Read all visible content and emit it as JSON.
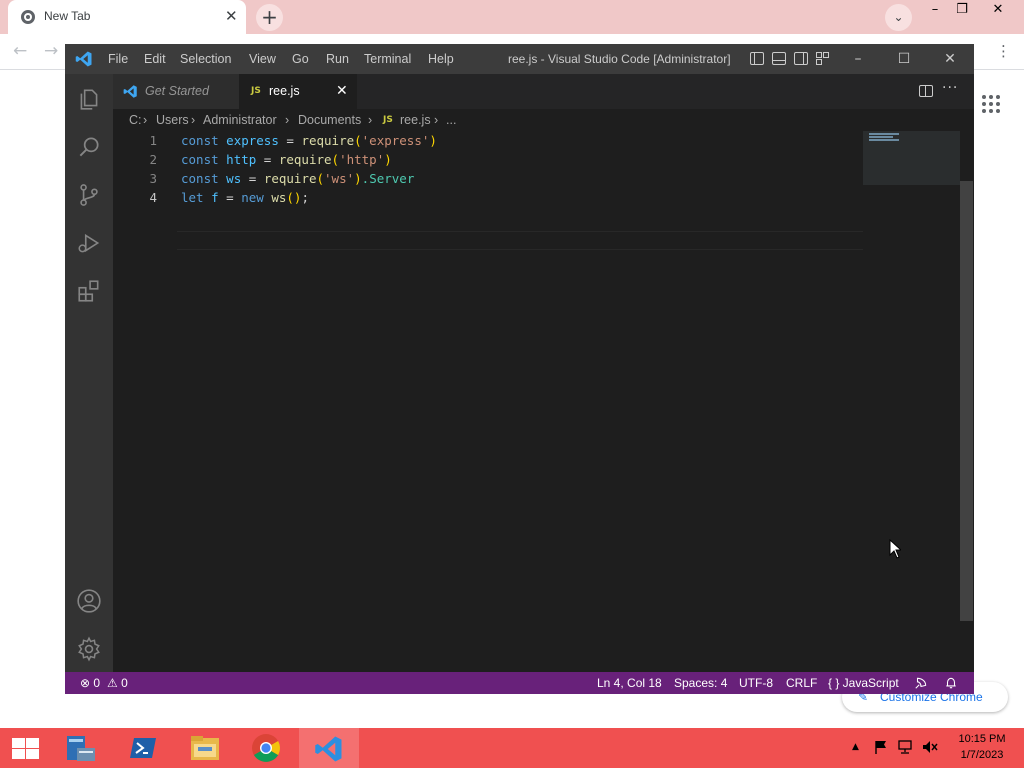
{
  "chrome": {
    "tab_title": "New Tab",
    "tab_close": "✕",
    "new_tab": "+",
    "dropdown": "⌄",
    "minimize": "–",
    "restore": "❐",
    "close": "✕",
    "back": "←",
    "forward": "→",
    "menu": "⋮",
    "customize_label": "Customize Chrome"
  },
  "vscode": {
    "window_title": "ree.js - Visual Studio Code [Administrator]",
    "menu": [
      "File",
      "Edit",
      "Selection",
      "View",
      "Go",
      "Run",
      "Terminal",
      "Help"
    ],
    "window_buttons": {
      "minimize": "–",
      "maximize": "☐",
      "close": "✕"
    },
    "tabs": [
      {
        "label": "Get Started"
      },
      {
        "label": "ree.js",
        "badge": "JS",
        "close": "✕"
      }
    ],
    "more_actions": "···",
    "breadcrumb": [
      "C:",
      "Users",
      "Administrator",
      "Documents",
      "ree.js",
      "..."
    ],
    "breadcrumb_sep": "›",
    "js_badge": "JS",
    "code": {
      "lines": [
        "1",
        "2",
        "3",
        "4"
      ],
      "l1": {
        "kw": "const",
        "var": "express",
        "eq": " = ",
        "fn": "require",
        "open": "(",
        "str": "'express'",
        "close": ")"
      },
      "l2": {
        "kw": "const",
        "var": "http",
        "eq": " = ",
        "fn": "require",
        "open": "(",
        "str": "'http'",
        "close": ")"
      },
      "l3": {
        "kw": "const",
        "var": "ws",
        "eq": " = ",
        "fn": "require",
        "open": "(",
        "str": "'ws'",
        "close": ")",
        "prop": ".Server"
      },
      "l4": {
        "kw": "let",
        "var": " f",
        "eq": " = ",
        "kw2": "new",
        "fn": " ws",
        "paren": "()",
        "end": ";"
      }
    },
    "status": {
      "errors": "⊗ 0",
      "warnings": "⚠ 0",
      "position": "Ln 4, Col 18",
      "spaces": "Spaces: 4",
      "encoding": "UTF-8",
      "eol": "CRLF",
      "language": "{ } JavaScript"
    },
    "colors": {
      "status_bar": "#68217a",
      "editor_bg": "#1e1e1e",
      "activity_bar": "#333333"
    }
  },
  "taskbar": {
    "time": "10:15 PM",
    "date": "1/7/2023",
    "tray_arrow": "▲",
    "color": "#f05050"
  }
}
